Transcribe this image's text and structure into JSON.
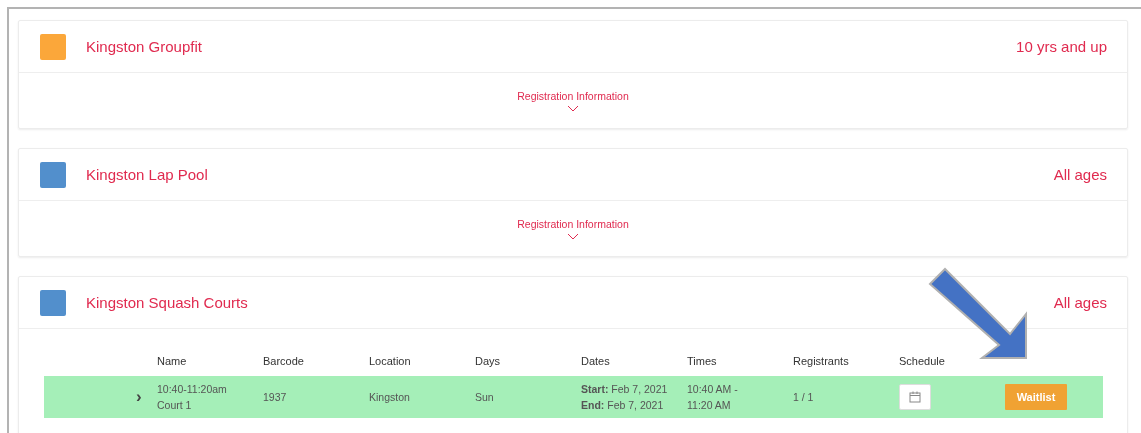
{
  "programs": [
    {
      "name": "Kingston Groupfit",
      "color": "#fba73a",
      "ages": "10 yrs and up",
      "expanded": false,
      "toggle": "Registration Information"
    },
    {
      "name": "Kingston Lap Pool",
      "color": "#528fcc",
      "ages": "All ages",
      "expanded": false,
      "toggle": "Registration Information"
    },
    {
      "name": "Kingston Squash Courts",
      "color": "#528fcc",
      "ages": "All ages",
      "expanded": true,
      "table": {
        "columns": [
          "Name",
          "Barcode",
          "Location",
          "Days",
          "Dates",
          "Times",
          "Registrants",
          "Schedule"
        ],
        "rows": [
          {
            "expander": "›",
            "name": [
              "10:40-11:20am",
              "Court 1"
            ],
            "barcode": "1937",
            "location": "Kingston",
            "days": "Sun",
            "dates": [
              "**Start:** Feb 7, 2021",
              "**End:** Feb 7, 2021"
            ],
            "times": [
              "10:40 AM  -",
              "11:20 AM"
            ],
            "registrants": "1 / 1",
            "action": "Waitlist"
          }
        ]
      }
    }
  ]
}
